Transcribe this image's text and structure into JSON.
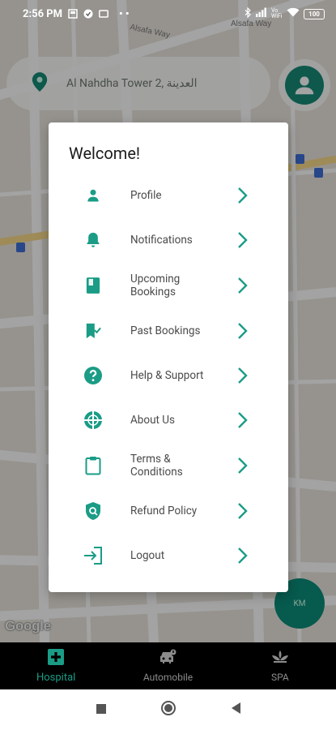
{
  "status_bar": {
    "time": "2:56 PM",
    "network_label": "Vo WiFi",
    "battery": "100"
  },
  "map": {
    "street_labels": [
      "Alsafa Way",
      "Alsafa Way"
    ],
    "google_logo": "Google"
  },
  "search": {
    "location_text": "Al Nahdha Tower 2, العدينة"
  },
  "modal": {
    "title": "Welcome!",
    "items": [
      {
        "label": "Profile",
        "icon": "person-icon"
      },
      {
        "label": "Notifications",
        "icon": "bell-icon"
      },
      {
        "label": "Upcoming Bookings",
        "icon": "book-icon"
      },
      {
        "label": "Past Bookings",
        "icon": "bookmark-check-icon"
      },
      {
        "label": "Help & Support",
        "icon": "help-circle-icon"
      },
      {
        "label": "About Us",
        "icon": "globe-icon"
      },
      {
        "label": "Terms & Conditions",
        "icon": "clipboard-icon"
      },
      {
        "label": "Refund Policy",
        "icon": "shield-search-icon"
      },
      {
        "label": "Logout",
        "icon": "logout-icon"
      }
    ]
  },
  "km_button": "KM",
  "tabs": [
    {
      "label": "Hospital",
      "icon": "hospital-cross-icon",
      "active": true
    },
    {
      "label": "Automobile",
      "icon": "car-icon",
      "active": false
    },
    {
      "label": "SPA",
      "icon": "lotus-icon",
      "active": false
    }
  ],
  "colors": {
    "accent": "#1a9c86",
    "accent_dark": "#178a77",
    "modal_bg": "#ffffff",
    "tabbar_bg": "#000000"
  }
}
